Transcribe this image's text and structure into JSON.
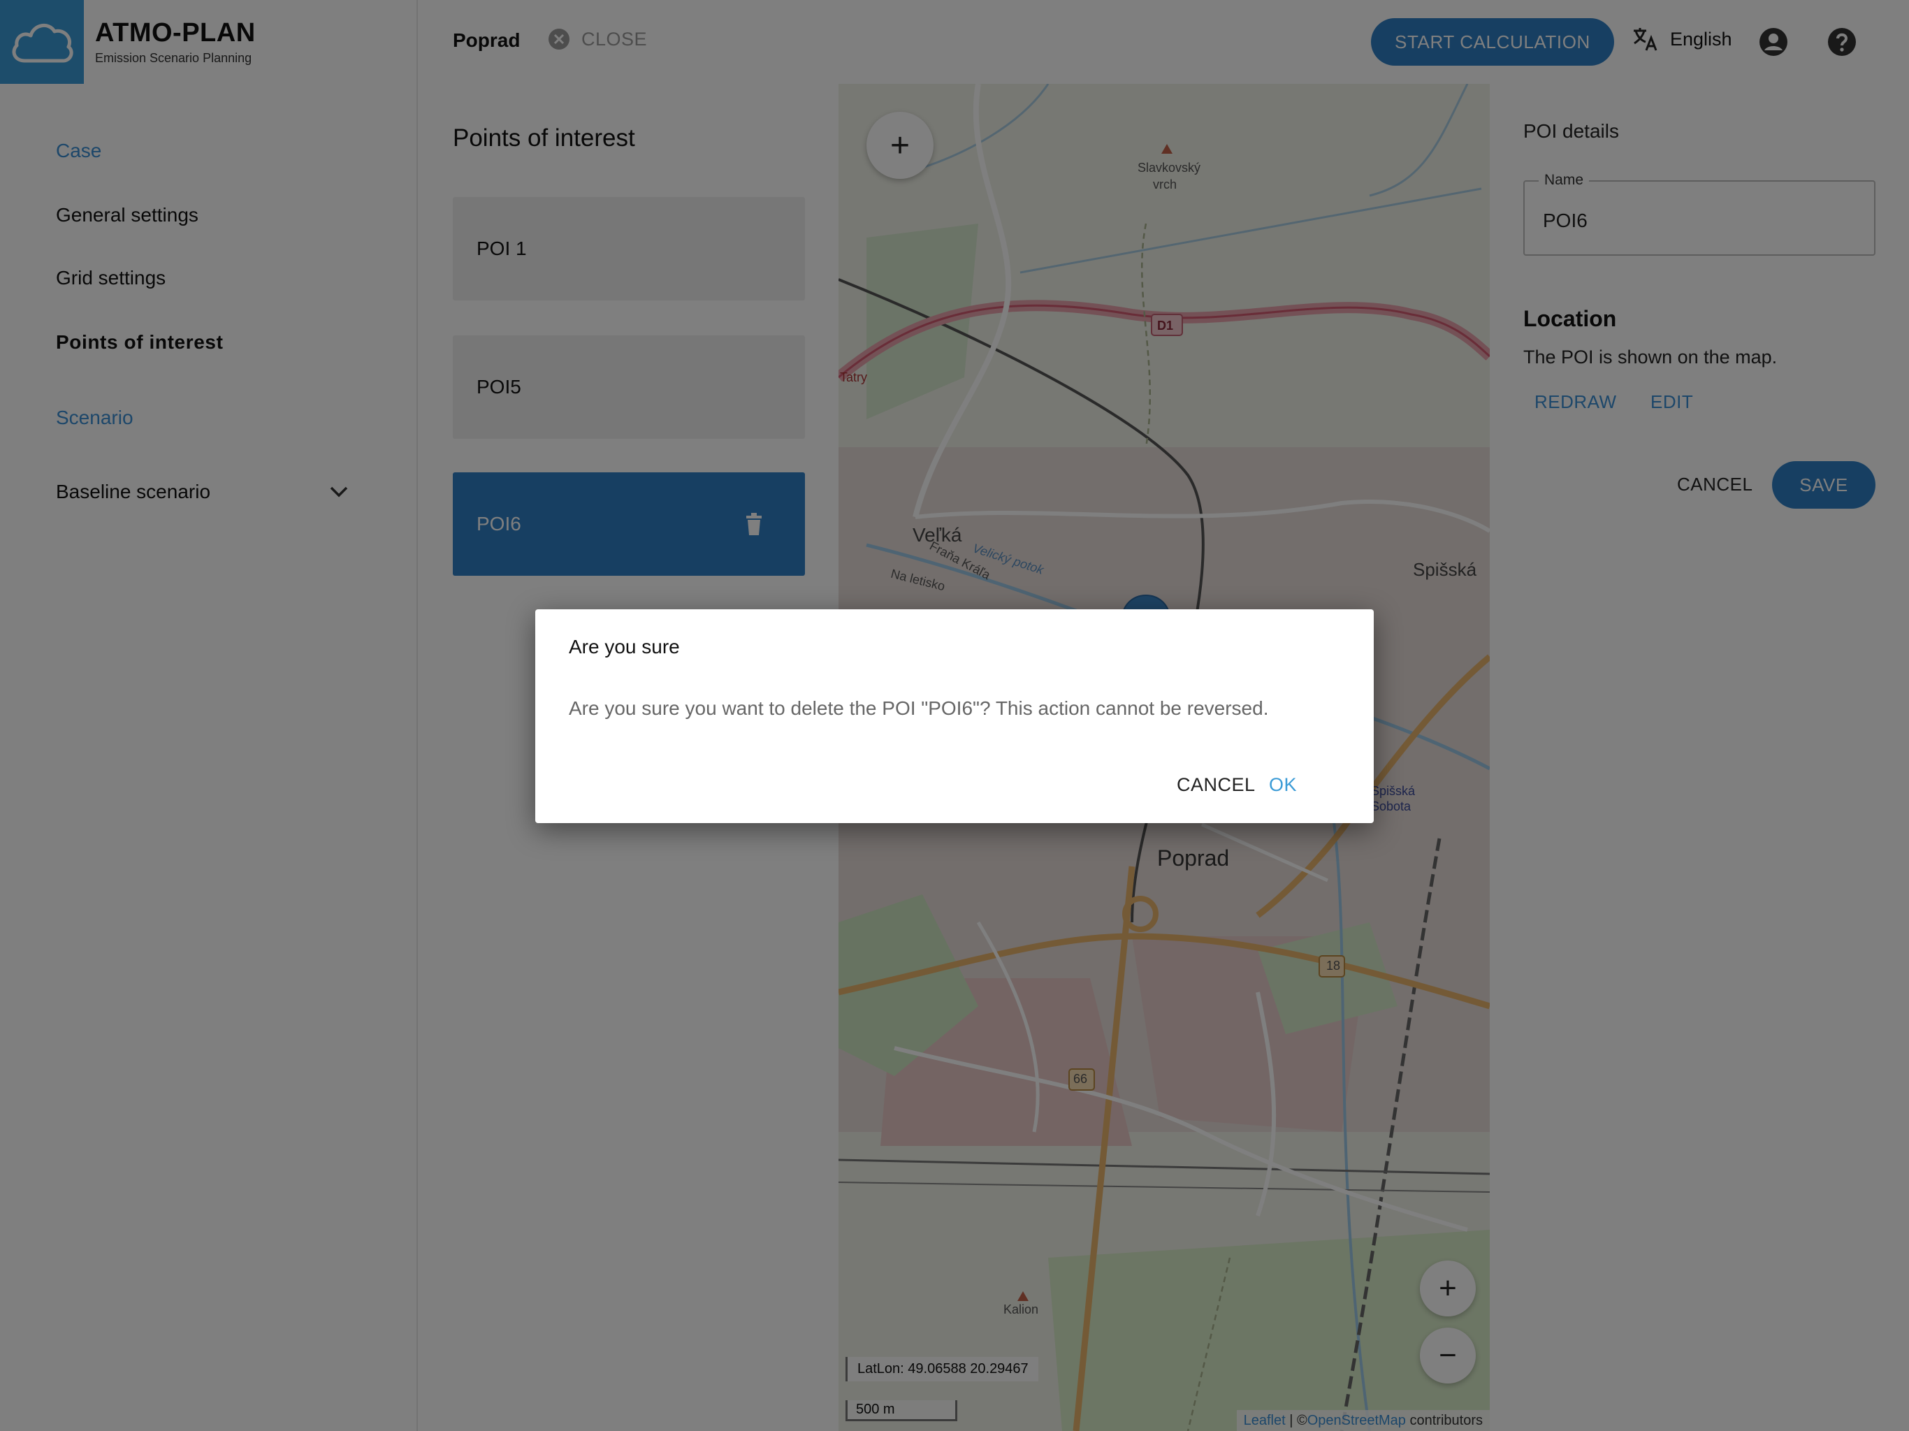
{
  "brand": {
    "name": "ATMO-PLAN",
    "subtitle": "Emission Scenario Planning"
  },
  "sidebar": {
    "items": [
      {
        "label": "Case",
        "style": "link"
      },
      {
        "label": "General settings",
        "style": "normal"
      },
      {
        "label": "Grid settings",
        "style": "normal"
      },
      {
        "label": "Points of interest",
        "style": "active"
      },
      {
        "label": "Scenario",
        "style": "link"
      }
    ],
    "scenario_select": {
      "value": "Baseline scenario",
      "icon": "chevron-down-icon"
    }
  },
  "topbar": {
    "case_name": "Poprad",
    "close_label": "CLOSE",
    "start_label": "START CALCULATION",
    "language": "English"
  },
  "poi_list": {
    "title": "Points of interest",
    "items": [
      {
        "name": "POI 1",
        "selected": false
      },
      {
        "name": "POI5",
        "selected": false
      },
      {
        "name": "POI6",
        "selected": true
      }
    ]
  },
  "map": {
    "labels": {
      "peak1": "Slavkovský",
      "peak1b": "vrch",
      "road_d1": "D1",
      "tatry": "Tatry",
      "velka": "Veľká",
      "street1": "Fraňa Kráľa",
      "street2": "Na letisko",
      "river": "Velický potok",
      "spisska": "Spišská",
      "spisska2": "Spišská",
      "sobota": "Sobota",
      "city": "Poprad",
      "road_18": "18",
      "road_66": "66",
      "peak2": "Kalion"
    },
    "latlon": "LatLon: 49.06588 20.29467",
    "scale": "500 m",
    "attribution": {
      "leaflet": "Leaflet",
      "sep": " | ©",
      "osm": "OpenStreetMap",
      "suffix": " contributors"
    },
    "zoom_in": "+",
    "zoom_out": "−",
    "add_poi": "+"
  },
  "details": {
    "title": "POI details",
    "name_label": "Name",
    "name_value": "POI6",
    "location_title": "Location",
    "location_desc": "The POI is shown on the map.",
    "redraw_label": "REDRAW",
    "edit_label": "EDIT",
    "cancel_label": "CANCEL",
    "save_label": "SAVE"
  },
  "dialog": {
    "title": "Are you sure",
    "body": "Are you sure you want to delete the POI \"POI6\"? This action cannot be reversed.",
    "cancel_label": "CANCEL",
    "ok_label": "OK"
  },
  "colors": {
    "accent": "#2f7fc4",
    "link": "#3b8fd4",
    "logo_bg": "#3b9bd6"
  }
}
